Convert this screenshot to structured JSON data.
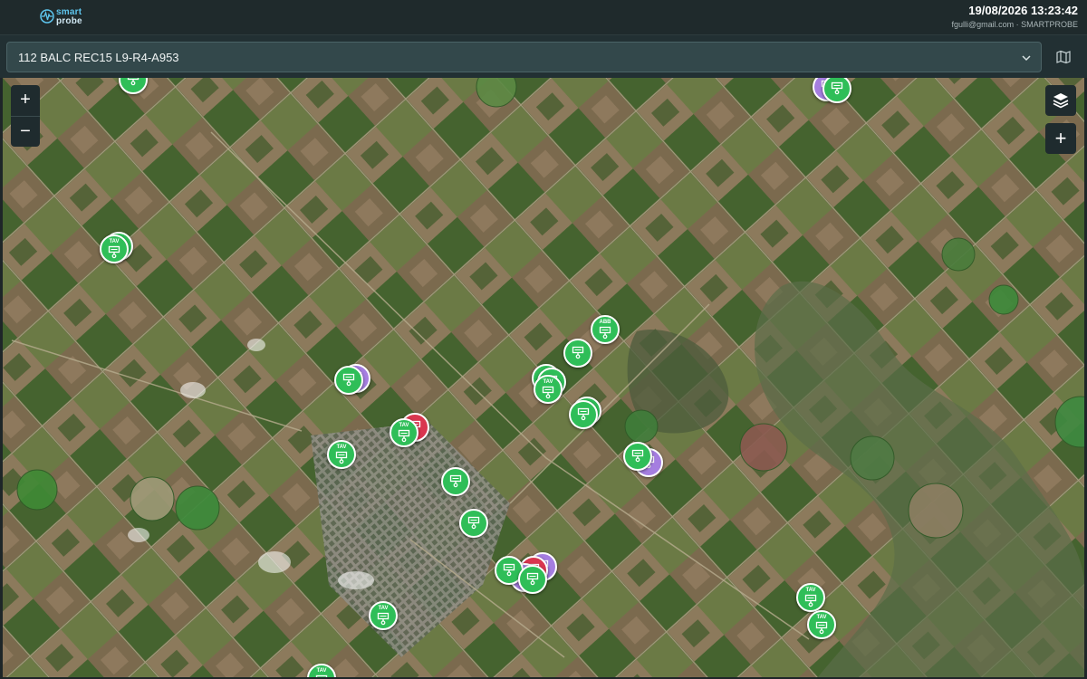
{
  "app": {
    "logo_line1": "smart",
    "logo_line2": "probe",
    "datetime": "19/08/2026 13:23:42",
    "user": "fgulli@gmail.com · SMARTPROBE"
  },
  "selector": {
    "value": "112 BALC REC15 L9-R4-A953",
    "chevron_icon": "chevron-down-icon",
    "map_icon": "map-icon"
  },
  "map_controls": {
    "zoom_in": "+",
    "zoom_out": "−",
    "layers_icon": "layers-icon",
    "add": "+"
  },
  "colors": {
    "marker_green": "#2fbe58",
    "marker_purple": "#a57ee0",
    "marker_red": "#d9364f",
    "accent": "#5ec6ef"
  },
  "markers": [
    {
      "label": "",
      "color": "green"
    },
    {
      "label": "",
      "color": "purple"
    },
    {
      "label": "",
      "color": "green"
    },
    {
      "label": "",
      "color": "green"
    },
    {
      "label": "TAV",
      "color": "green"
    },
    {
      "label": "ABB",
      "color": "green"
    },
    {
      "label": "",
      "color": "green"
    },
    {
      "label": "",
      "color": "purple"
    },
    {
      "label": "",
      "color": "green"
    },
    {
      "label": "",
      "color": "green"
    },
    {
      "label": "",
      "color": "green"
    },
    {
      "label": "TAV",
      "color": "green"
    },
    {
      "label": "",
      "color": "green"
    },
    {
      "label": "",
      "color": "green"
    },
    {
      "label": "",
      "color": "red"
    },
    {
      "label": "TAV",
      "color": "green"
    },
    {
      "label": "TAV",
      "color": "green"
    },
    {
      "label": "",
      "color": "green"
    },
    {
      "label": "",
      "color": "purple"
    },
    {
      "label": "",
      "color": "green"
    },
    {
      "label": "",
      "color": "green"
    },
    {
      "label": "",
      "color": "purple"
    },
    {
      "label": "",
      "color": "red"
    },
    {
      "label": "",
      "color": "purple"
    },
    {
      "label": "",
      "color": "green"
    },
    {
      "label": "",
      "color": "green"
    },
    {
      "label": "TAV",
      "color": "green"
    },
    {
      "label": "TAV",
      "color": "green"
    },
    {
      "label": "TAV",
      "color": "green"
    },
    {
      "label": "TAV",
      "color": "green"
    }
  ]
}
